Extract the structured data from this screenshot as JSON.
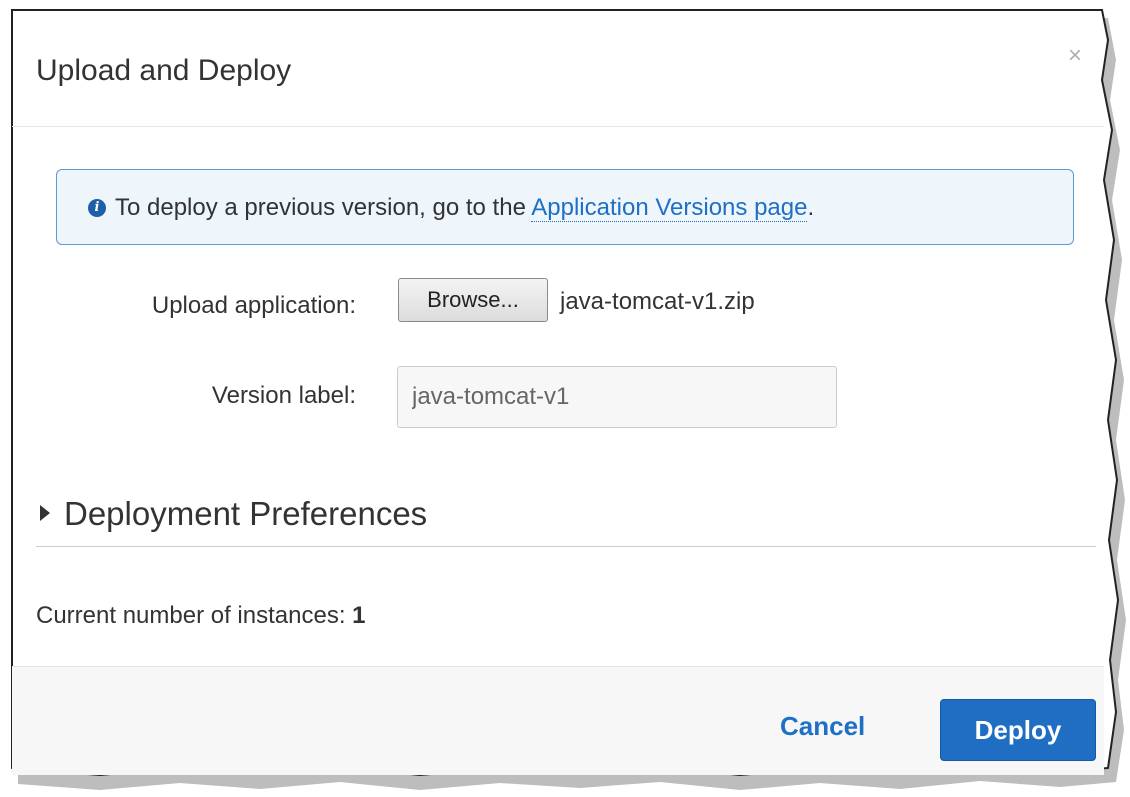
{
  "dialog": {
    "title": "Upload and Deploy",
    "close_glyph": "×",
    "close_icon": "close-icon"
  },
  "info": {
    "icon": "info-icon",
    "icon_glyph": "i",
    "text": "To deploy a previous version, go to the ",
    "link_text": "Application Versions page",
    "suffix": "."
  },
  "upload": {
    "label": "Upload application:",
    "browse_label": "Browse...",
    "file_name": "java-tomcat-v1.zip"
  },
  "version": {
    "label": "Version label:",
    "value": "java-tomcat-v1"
  },
  "preferences": {
    "label": "Deployment Preferences",
    "expanded": false,
    "icon": "caret-right-icon"
  },
  "instances": {
    "label": "Current number of instances: ",
    "count": "1"
  },
  "footer": {
    "cancel_label": "Cancel",
    "deploy_label": "Deploy"
  },
  "colors": {
    "accent": "#1f6ec4",
    "info_border": "#5b9bd5",
    "info_bg": "#eef6fc"
  }
}
